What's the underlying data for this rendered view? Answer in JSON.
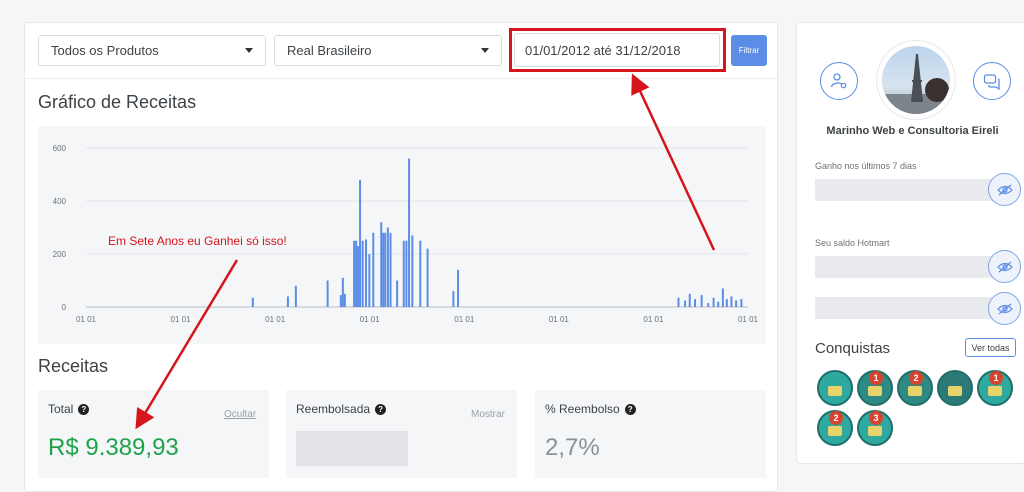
{
  "filters": {
    "product": "Todos os Produtos",
    "currency": "Real Brasileiro",
    "date_range": "01/01/2012 até 31/12/2018",
    "filter_button": "Filtrar"
  },
  "chart_section": {
    "title": "Gráfico de Receitas",
    "annotation": "Em Sete Anos eu Ganhei só isso!"
  },
  "chart_data": {
    "type": "bar",
    "title": "",
    "xlabel": "",
    "ylabel": "",
    "ylim": [
      0,
      600
    ],
    "y_ticks": [
      "0",
      "200",
      "400",
      "600"
    ],
    "x_tick_labels": [
      "01 01",
      "01 01",
      "01 01",
      "01 01",
      "01 01",
      "01 01",
      "01 01",
      "01 01"
    ],
    "grid": true,
    "color": "#5b8de6",
    "bars": [
      {
        "x": 0.252,
        "v": 35
      },
      {
        "x": 0.305,
        "v": 40
      },
      {
        "x": 0.317,
        "v": 80
      },
      {
        "x": 0.365,
        "v": 100
      },
      {
        "x": 0.385,
        "v": 45
      },
      {
        "x": 0.388,
        "v": 110
      },
      {
        "x": 0.391,
        "v": 50
      },
      {
        "x": 0.405,
        "v": 250
      },
      {
        "x": 0.408,
        "v": 250
      },
      {
        "x": 0.411,
        "v": 230
      },
      {
        "x": 0.414,
        "v": 480
      },
      {
        "x": 0.418,
        "v": 250
      },
      {
        "x": 0.423,
        "v": 255
      },
      {
        "x": 0.428,
        "v": 200
      },
      {
        "x": 0.434,
        "v": 280
      },
      {
        "x": 0.446,
        "v": 320
      },
      {
        "x": 0.449,
        "v": 280
      },
      {
        "x": 0.452,
        "v": 280
      },
      {
        "x": 0.456,
        "v": 300
      },
      {
        "x": 0.46,
        "v": 280
      },
      {
        "x": 0.47,
        "v": 100
      },
      {
        "x": 0.48,
        "v": 250
      },
      {
        "x": 0.484,
        "v": 250
      },
      {
        "x": 0.488,
        "v": 560
      },
      {
        "x": 0.493,
        "v": 270
      },
      {
        "x": 0.505,
        "v": 250
      },
      {
        "x": 0.516,
        "v": 220
      },
      {
        "x": 0.555,
        "v": 60
      },
      {
        "x": 0.562,
        "v": 140
      },
      {
        "x": 0.895,
        "v": 35
      },
      {
        "x": 0.905,
        "v": 25
      },
      {
        "x": 0.912,
        "v": 50
      },
      {
        "x": 0.92,
        "v": 30
      },
      {
        "x": 0.93,
        "v": 45
      },
      {
        "x": 0.94,
        "v": 15
      },
      {
        "x": 0.948,
        "v": 35
      },
      {
        "x": 0.955,
        "v": 20
      },
      {
        "x": 0.962,
        "v": 70
      },
      {
        "x": 0.968,
        "v": 30
      },
      {
        "x": 0.975,
        "v": 40
      },
      {
        "x": 0.982,
        "v": 25
      },
      {
        "x": 0.99,
        "v": 30
      }
    ]
  },
  "receitas": {
    "title": "Receitas",
    "total": {
      "label": "Total",
      "action": "Ocultar",
      "value": "R$ 9.389,93"
    },
    "refunded": {
      "label": "Reembolsada",
      "action": "Mostrar"
    },
    "refund_pct": {
      "label": "% Reembolso",
      "value": "2,7%"
    }
  },
  "sidebar": {
    "company_name": "Marinho Web e Consultoria Eireli",
    "earned_7_days_label": "Ganho nos últimos 7 dias",
    "balance_label": "Seu saldo Hotmart",
    "achievements_title": "Conquistas",
    "see_all": "Ver todas",
    "badges": [
      {
        "icon": "certificate-badge-icon",
        "number": ""
      },
      {
        "icon": "level-1-badge-icon",
        "number": "1"
      },
      {
        "icon": "level-2-badge-icon",
        "number": "2"
      },
      {
        "icon": "trophy-badge-icon",
        "number": ""
      },
      {
        "icon": "level-1-money-badge-icon",
        "number": "1"
      },
      {
        "icon": "level-2-money-badge-icon",
        "number": "2"
      },
      {
        "icon": "level-3-money-badge-icon",
        "number": "3"
      }
    ]
  }
}
